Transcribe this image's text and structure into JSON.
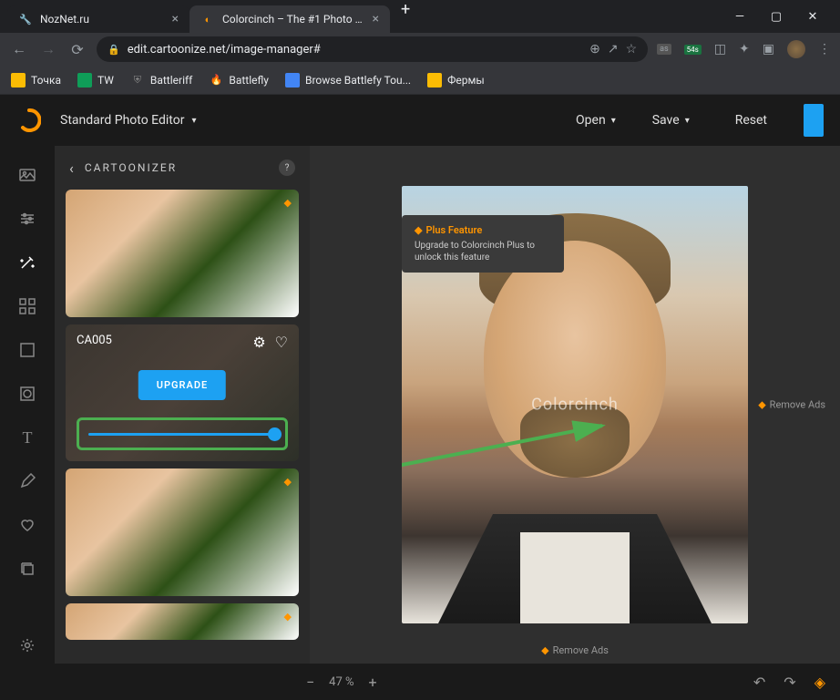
{
  "browser": {
    "tabs": [
      {
        "title": "NozNet.ru",
        "active": false
      },
      {
        "title": "Colorcinch – The #1 Photo Editor",
        "active": true
      }
    ],
    "url": "edit.cartoonize.net/image-manager#",
    "ext_badge": "54s",
    "bookmarks": [
      {
        "label": "Точка",
        "color": "#fbbc04"
      },
      {
        "label": "TW",
        "color": "#0f9d58"
      },
      {
        "label": "Battleriff",
        "color": "#5f6368"
      },
      {
        "label": "Battlefly",
        "color": "#ea4335"
      },
      {
        "label": "Browse Battlefy Tou...",
        "color": "#4285f4"
      },
      {
        "label": "Фермы",
        "color": "#fbbc04"
      }
    ]
  },
  "header": {
    "mode": "Standard Photo Editor",
    "open": "Open",
    "save": "Save",
    "reset": "Reset"
  },
  "panel": {
    "title": "CARTOONIZER",
    "selected_preset": "CA005",
    "upgrade": "UPGRADE"
  },
  "tooltip": {
    "title": "Plus Feature",
    "desc": "Upgrade to Colorcinch Plus to unlock this feature"
  },
  "canvas": {
    "watermark": "Colorcinch",
    "remove_ads": "Remove Ads"
  },
  "status": {
    "zoom": "47 %"
  }
}
